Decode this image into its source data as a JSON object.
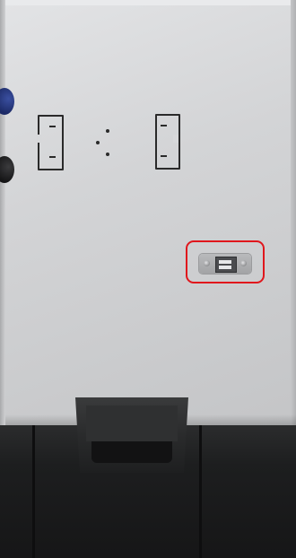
{
  "photo": {
    "subject": "device-panel-with-usb-port",
    "colors": {
      "panel": "#d3d4d6",
      "stencil": "#2a2a2a",
      "highlight": "#e0161c",
      "base": "#1d1e1f",
      "knob_blue": "#2a3b85",
      "knob_black": "#1e1e20"
    }
  }
}
